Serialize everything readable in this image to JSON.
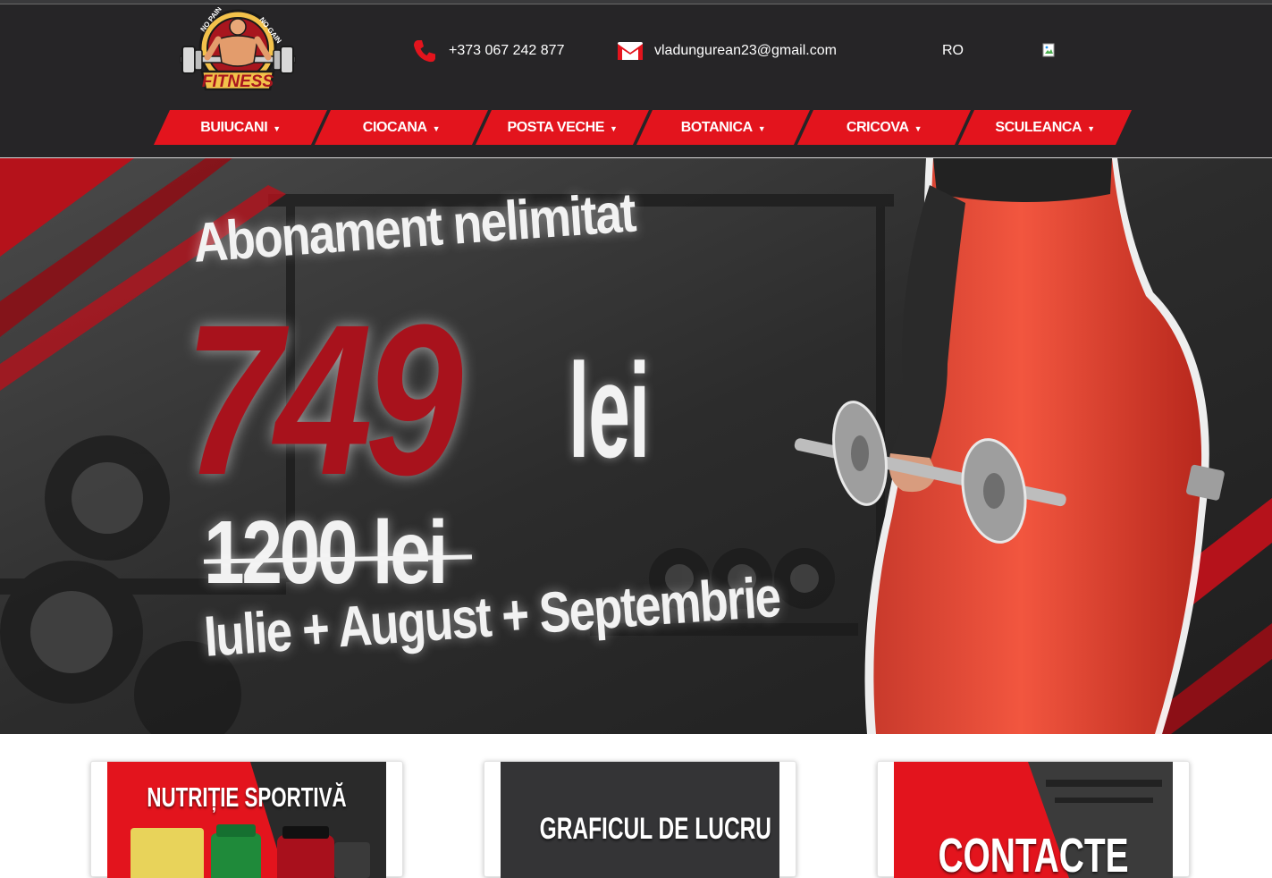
{
  "header": {
    "phone": "+373 067 242 877",
    "email": "vladungurean23@gmail.com",
    "language": "RO",
    "logo": {
      "top_left": "NO PAIN",
      "top_right": "NO GAIN",
      "word": "FITNESS"
    }
  },
  "nav": {
    "items": [
      {
        "label": "BUIUCANI"
      },
      {
        "label": "CIOCANA"
      },
      {
        "label": "POSTA VECHE"
      },
      {
        "label": "BOTANICA"
      },
      {
        "label": "CRICOVA"
      },
      {
        "label": "SCULEANCA"
      }
    ],
    "caret_icon": "caret-down-icon"
  },
  "hero": {
    "headline": "Abonament nelimitat",
    "price": "749",
    "currency": "lei",
    "old_price": "1200 lei",
    "months": "Iulie + August + Septembrie"
  },
  "cards": [
    {
      "title": "NUTRIȚIE SPORTIVĂ"
    },
    {
      "title": "GRAFICUL DE LUCRU"
    },
    {
      "title": "CONTACTE"
    }
  ],
  "colors": {
    "header_bg": "#262527",
    "accent_red": "#e3141d",
    "price_red": "#a8121c"
  }
}
